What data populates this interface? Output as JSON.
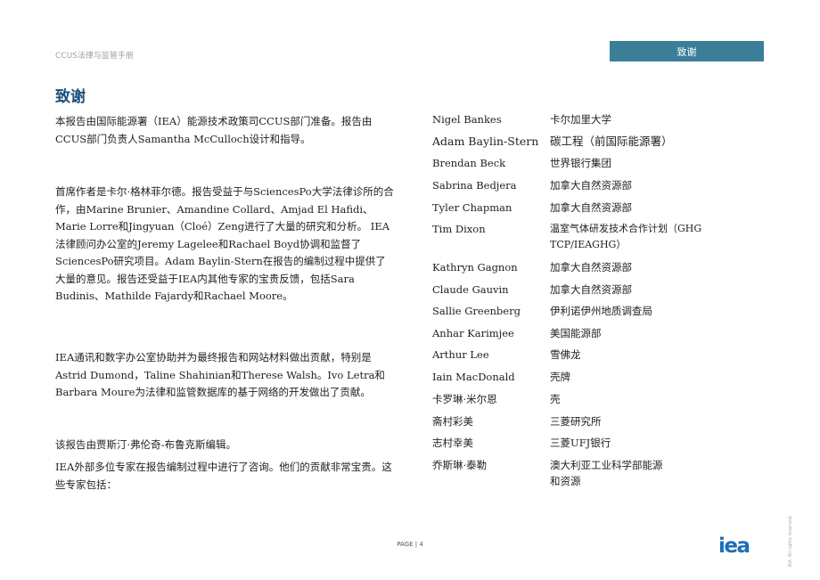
{
  "header": {
    "running_title": "CCUS法律与监管手册",
    "section_tab": "致谢"
  },
  "main": {
    "heading": "致谢",
    "paragraphs": [
      "本报告由国际能源署（IEA）能源技术政策司CCUS部门准备。报告由CCUS部门负责人Samantha McCulloch设计和指导。",
      "首席作者是卡尔·格林菲尔德。报告受益于与SciencesPo大学法律诊所的合作，由Marine Brunier、Amandine Collard、Amjad El Hafidi、Marie Lorre和Jingyuan（Cloé）Zeng进行了大量的研究和分析。 IEA法律顾问办公室的Jeremy Lagelee和Rachael Boyd协调和监督了SciencesPo研究项目。Adam Baylin-Stern在报告的编制过程中提供了大量的意见。报告还受益于IEA内其他专家的宝贵反馈，包括Sara Budinis、Mathilde Fajardy和Rachael Moore。",
      "IEA通讯和数字办公室协助并为最终报告和网站材料做出贡献，特别是Astrid Dumond，Taline Shahinian和Therese Walsh。Ivo Letra和Barbara Moure为法律和监管数据库的基于网络的开发做出了贡献。",
      "该报告由贾斯汀·弗伦奇-布鲁克斯编辑。",
      "IEA外部多位专家在报告编制过程中进行了咨询。他们的贡献非常宝贵。这些专家包括："
    ]
  },
  "contributors": [
    {
      "name": "Nigel Bankes",
      "org": "卡尔加里大学"
    },
    {
      "name": "Adam Baylin-Stern",
      "org": "碳工程（前国际能源署）"
    },
    {
      "name": "Brendan Beck",
      "org": "世界银行集团"
    },
    {
      "name": "Sabrina Bedjera",
      "org": "加拿大自然资源部"
    },
    {
      "name": "Tyler Chapman",
      "org": "加拿大自然资源部"
    },
    {
      "name": "Tim Dixon",
      "org": "温室气体研发技术合作计划（GHG TCP/IEAGHG）"
    },
    {
      "name": "Kathryn Gagnon",
      "org": "加拿大自然资源部"
    },
    {
      "name": "Claude Gauvin",
      "org": "加拿大自然资源部"
    },
    {
      "name": "Sallie Greenberg",
      "org": "伊利诺伊州地质调查局"
    },
    {
      "name": "Anhar Karimjee",
      "org": "美国能源部"
    },
    {
      "name": "Arthur Lee",
      "org": "雪佛龙"
    },
    {
      "name": "Iain MacDonald",
      "org": "壳牌"
    },
    {
      "name": "卡罗琳·米尔恩",
      "org": "壳"
    },
    {
      "name": "斋村彩美",
      "org": "三菱研究所"
    },
    {
      "name": "志村幸美",
      "org": "三菱UFJ银行"
    },
    {
      "name": "乔斯琳·泰勒",
      "org": "澳大利亚工业科学部能源和资源"
    }
  ],
  "footer": {
    "page_label": "PAGE | 4",
    "logo_text": "iea",
    "rights": "IEA. All rights reserved.",
    "logo_color": "#1d6fb8"
  }
}
